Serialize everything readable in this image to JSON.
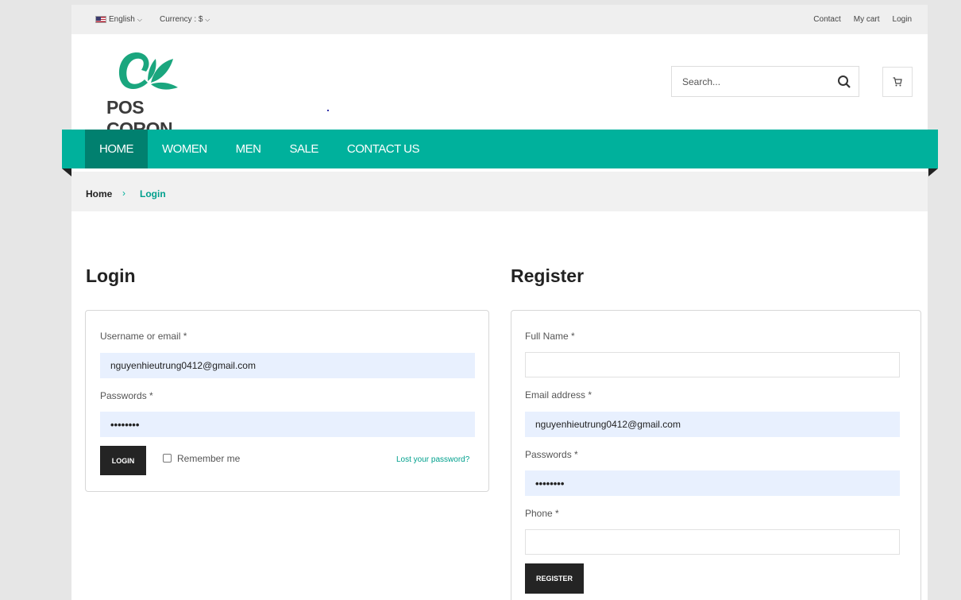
{
  "topbar": {
    "language": "English",
    "currency": "Currency : $",
    "links": [
      "Contact",
      "My cart",
      "Login"
    ]
  },
  "header": {
    "logo_text": "POS CORON",
    "search_placeholder": "Search..."
  },
  "nav": {
    "items": [
      "HOME",
      "WOMEN",
      "MEN",
      "SALE",
      "CONTACT US"
    ],
    "active": "HOME"
  },
  "breadcrumb": {
    "home": "Home",
    "separator": "›",
    "current": "Login"
  },
  "login": {
    "title": "Login",
    "username_label": "Username or email *",
    "username_value": "nguyenhieutrung0412@gmail.com",
    "password_label": "Passwords *",
    "password_value": "••••••••",
    "button": "LOGIN",
    "remember": "Remember me",
    "lost": "Lost your password?"
  },
  "register": {
    "title": "Register",
    "fullname_label": "Full Name *",
    "fullname_value": "",
    "email_label": "Email address *",
    "email_value": "nguyenhieutrung0412@gmail.com",
    "password_label": "Passwords *",
    "password_value": "••••••••",
    "phone_label": "Phone *",
    "phone_value": "",
    "button": "REGISTER"
  },
  "colors": {
    "accent": "#00b19c",
    "nav_active": "#01806f",
    "button": "#242424"
  }
}
